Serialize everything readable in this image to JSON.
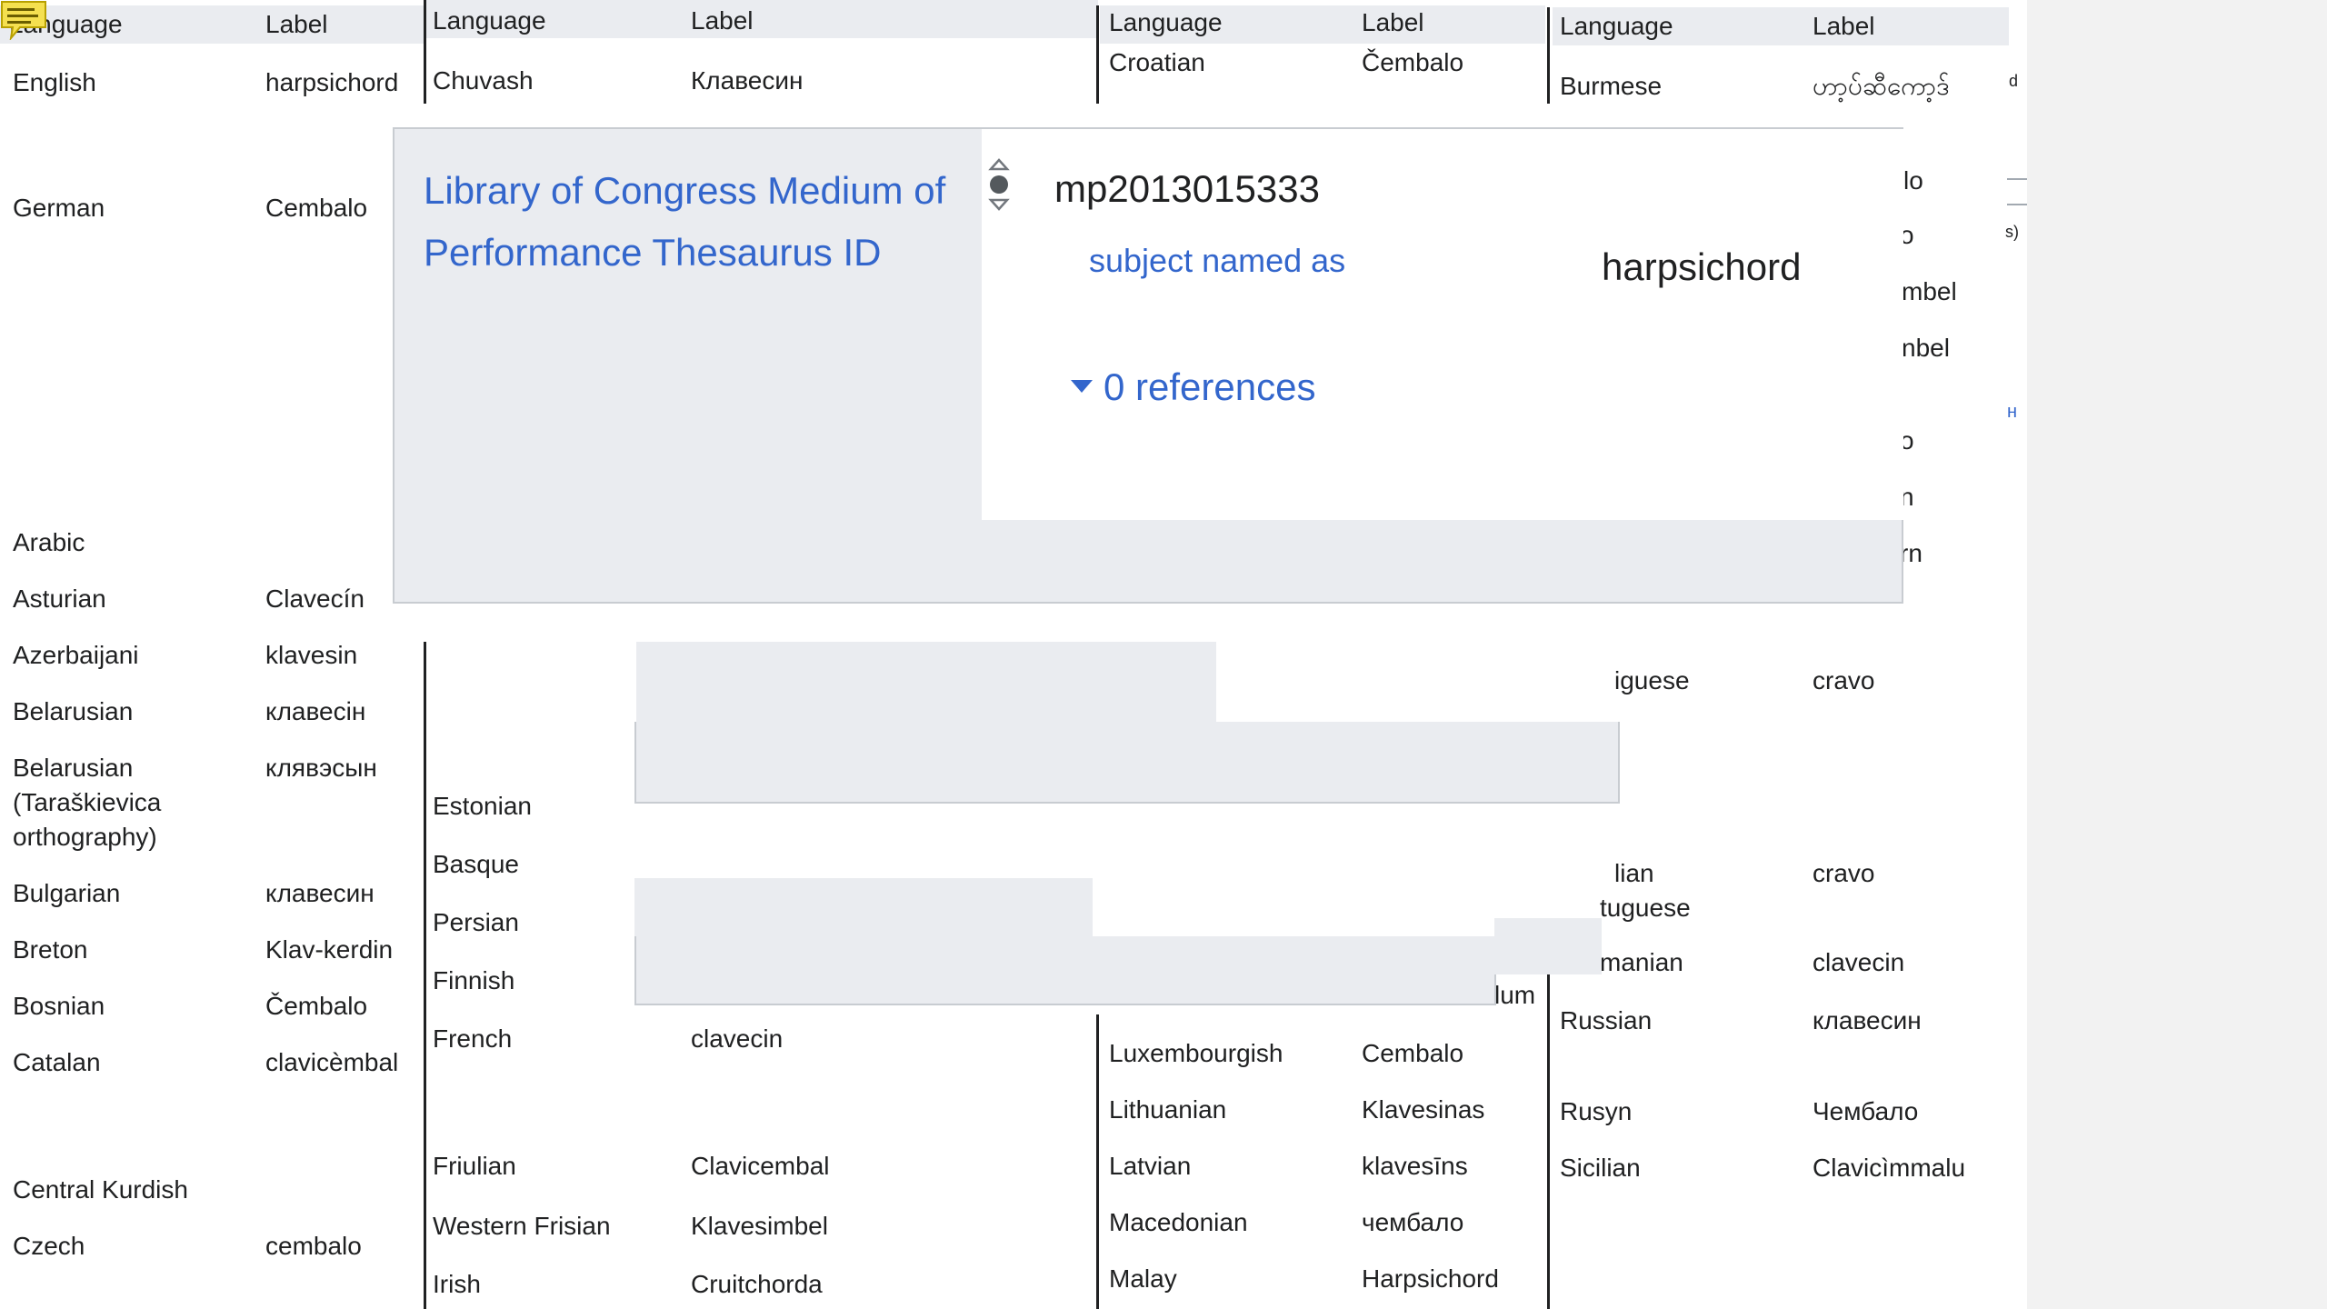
{
  "table1": {
    "header": {
      "language": "Language",
      "label": "Label"
    },
    "rows": [
      {
        "lang": "English",
        "label": "harpsichord"
      },
      {
        "lang": "German",
        "label": "Cembalo"
      },
      {
        "lang": "Arabic",
        "label": ""
      },
      {
        "lang": "Asturian",
        "label": "Clavecín"
      },
      {
        "lang": "Azerbaijani",
        "label": "klavesin"
      },
      {
        "lang": "Belarusian",
        "label": "клавесін"
      },
      {
        "lang": "Belarusian (Taraškievica orthography)",
        "lang_lines": [
          "Belarusian",
          "(Taraškievica",
          "orthography)"
        ],
        "label": "клявэсын"
      },
      {
        "lang": "Bulgarian",
        "label": "клавесин"
      },
      {
        "lang": "Breton",
        "label": "Klav-kerdin"
      },
      {
        "lang": "Bosnian",
        "label": "Čembalo"
      },
      {
        "lang": "Catalan",
        "label": "clavicèmbal"
      },
      {
        "lang": "Central Kurdish",
        "label": ""
      },
      {
        "lang": "Czech",
        "label": "cembalo"
      }
    ]
  },
  "table2": {
    "header": {
      "language": "Language",
      "label": "Label"
    },
    "rows": [
      {
        "lang": "Chuvash",
        "label": "Клавесин"
      },
      {
        "lang": "Estonian",
        "label": ""
      },
      {
        "lang": "Basque",
        "label": ""
      },
      {
        "lang": "Persian",
        "label": ""
      },
      {
        "lang": "Finnish",
        "label": ""
      },
      {
        "lang": "French",
        "label": "clavecin"
      },
      {
        "lang": "Friulian",
        "label": "Clavicembal"
      },
      {
        "lang": "Western Frisian",
        "label": "Klavesimbel"
      },
      {
        "lang": "Irish",
        "label": "Cruitchorda"
      }
    ]
  },
  "table3": {
    "header": {
      "language": "Language",
      "label": "Label"
    },
    "rows": [
      {
        "lang": "Croatian",
        "label": "Čembalo"
      },
      {
        "lang": "Luxembourgish",
        "label": "Cembalo"
      },
      {
        "lang": "Lithuanian",
        "label": "Klavesinas"
      },
      {
        "lang": "Latvian",
        "label": "klavesīns"
      },
      {
        "lang": "Macedonian",
        "label": "чембало"
      },
      {
        "lang": "Malay",
        "label": "Harpsichord"
      }
    ],
    "fragment": "lum"
  },
  "table4": {
    "header": {
      "language": "Language",
      "label": "Label"
    },
    "rows": [
      {
        "lang": "Burmese",
        "label": "ဟာ့ပ်ဆီကော့ဒ်"
      },
      {
        "lang": "Russian",
        "label": "клавесин"
      },
      {
        "lang": "Rusyn",
        "label": "Чембало"
      },
      {
        "lang": "Sicilian",
        "label": "Clavicìmmalu"
      }
    ],
    "fragments": {
      "lo": "lo",
      "o1": "o",
      "mbel": "mbel",
      "nbel": "nbel",
      "o2": "o",
      "n1": "n",
      "rn": "rn",
      "guese": "iguese",
      "cravo1": "cravo",
      "lian": "lian",
      "tuguese": "tuguese",
      "cravo2": "cravo",
      "manian": "manian",
      "clavecin": "clavecin",
      "d": "d",
      "s": "s)",
      "h": "н"
    }
  },
  "popup": {
    "property": "Library of Congress Medium of Performance Thesaurus ID",
    "value": "mp2013015333",
    "qualifier_label": "subject named as",
    "qualifier_value": "harpsichord",
    "references": "0 references"
  },
  "colors": {
    "link": "#3366cc",
    "header_bg": "#eaecf0",
    "text": "#202122",
    "note_icon": "#f5e050"
  },
  "icons": {
    "note": "note-icon",
    "rank": "rank-selector-icon",
    "caret": "caret-down-icon"
  }
}
